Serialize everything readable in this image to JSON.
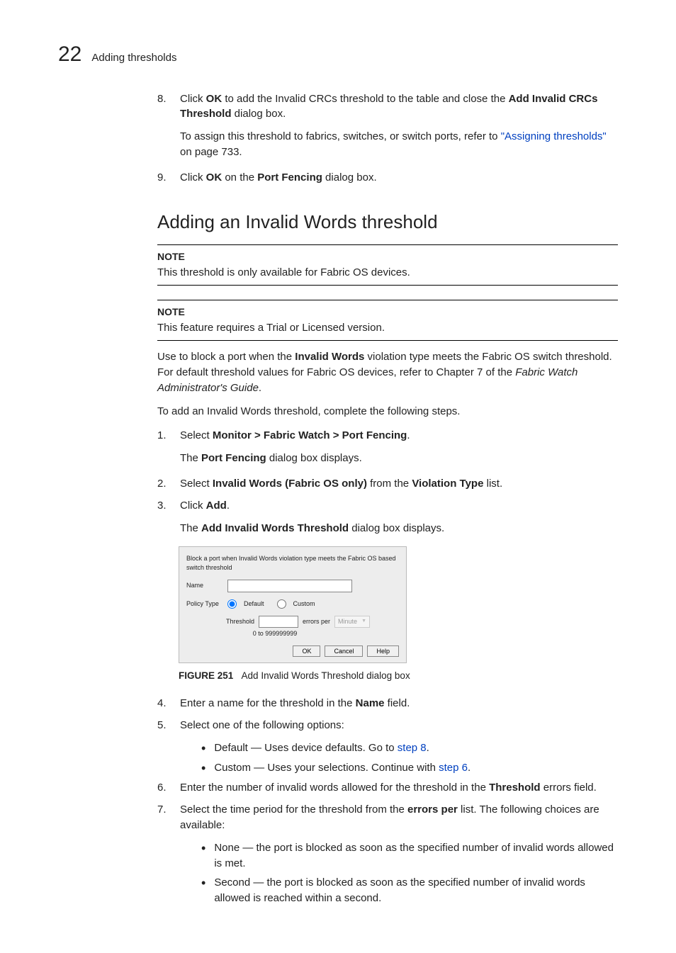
{
  "header": {
    "chapnum": "22",
    "chaptitle": "Adding thresholds"
  },
  "step8": {
    "num": "8.",
    "pre": "Click ",
    "ok": "OK",
    "mid": " to add the Invalid CRCs threshold to the table and close the ",
    "bold": "Add Invalid CRCs Threshold",
    "post": " dialog box.",
    "assign_pre": "To assign this threshold to fabrics, switches, or switch ports, refer to ",
    "assign_link": "\"Assigning thresholds\"",
    "assign_post": " on page 733."
  },
  "step9": {
    "num": "9.",
    "pre": "Click ",
    "ok": "OK",
    "mid": " on the ",
    "bold": "Port Fencing",
    "post": " dialog box."
  },
  "section_title": "Adding an Invalid Words threshold",
  "note1": {
    "label": "NOTE",
    "text": "This threshold is only available for Fabric OS devices."
  },
  "note2": {
    "label": "NOTE",
    "text": "This feature requires a Trial or Licensed version."
  },
  "intro": {
    "p1a": "Use to block a port when the ",
    "p1bold": "Invalid Words",
    "p1b": " violation type meets the Fabric OS switch threshold. For default threshold values for Fabric OS devices, refer to Chapter 7 of the ",
    "p1ital": "Fabric Watch Administrator's Guide",
    "p1end": ".",
    "p2": "To add an Invalid Words threshold, complete the following steps."
  },
  "s1": {
    "num": "1.",
    "pre": "Select ",
    "path": "Monitor > Fabric Watch > Port Fencing",
    "post": ".",
    "sub_pre": "The ",
    "sub_bold": "Port Fencing",
    "sub_post": " dialog box displays."
  },
  "s2": {
    "num": "2.",
    "pre": "Select ",
    "b1": "Invalid Words (Fabric OS only)",
    "mid": " from the ",
    "b2": "Violation Type",
    "post": " list."
  },
  "s3": {
    "num": "3.",
    "pre": "Click ",
    "b": "Add",
    "post": ".",
    "sub_pre": "The ",
    "sub_bold": "Add Invalid Words Threshold",
    "sub_post": " dialog box displays."
  },
  "dialog": {
    "desc": "Block a port when Invalid Words violation type meets the Fabric OS based switch threshold",
    "name_lbl": "Name",
    "policy_lbl": "Policy Type",
    "default": "Default",
    "custom": "Custom",
    "thresh_lbl": "Threshold",
    "errors_per": "errors per",
    "minute": "Minute",
    "range": "0 to 999999999",
    "ok": "OK",
    "cancel": "Cancel",
    "help": "Help"
  },
  "figure": {
    "label": "FIGURE 251",
    "caption": "Add Invalid Words Threshold dialog box"
  },
  "s4": {
    "num": "4.",
    "pre": "Enter a name for the threshold in the ",
    "b": "Name",
    "post": " field."
  },
  "s5": {
    "num": "5.",
    "text": "Select one of the following options:",
    "b1_pre": "Default — Uses device defaults. Go to ",
    "b1_link": "step 8",
    "b1_post": ".",
    "b2_pre": "Custom — Uses your selections. Continue with ",
    "b2_link": "step 6",
    "b2_post": "."
  },
  "s6": {
    "num": "6.",
    "pre": "Enter the number of invalid words allowed for the threshold in the ",
    "b": "Threshold",
    "post": " errors field."
  },
  "s7": {
    "num": "7.",
    "pre": "Select the time period for the threshold from the ",
    "b": "errors per",
    "post": " list. The following choices are available:",
    "b1": "None — the port is blocked as soon as the specified number of invalid words allowed is met.",
    "b2": "Second — the port is blocked as soon as the specified number of invalid words allowed is reached within a second."
  }
}
